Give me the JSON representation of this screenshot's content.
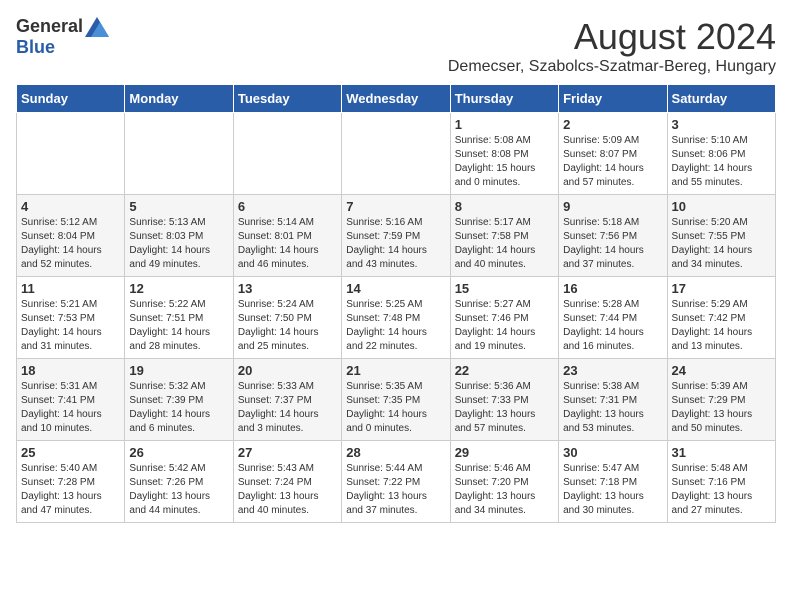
{
  "logo": {
    "general": "General",
    "blue": "Blue"
  },
  "title": {
    "month": "August 2024",
    "location": "Demecser, Szabolcs-Szatmar-Bereg, Hungary"
  },
  "header": {
    "days": [
      "Sunday",
      "Monday",
      "Tuesday",
      "Wednesday",
      "Thursday",
      "Friday",
      "Saturday"
    ]
  },
  "weeks": [
    {
      "days": [
        {
          "num": "",
          "info": ""
        },
        {
          "num": "",
          "info": ""
        },
        {
          "num": "",
          "info": ""
        },
        {
          "num": "",
          "info": ""
        },
        {
          "num": "1",
          "info": "Sunrise: 5:08 AM\nSunset: 8:08 PM\nDaylight: 15 hours\nand 0 minutes."
        },
        {
          "num": "2",
          "info": "Sunrise: 5:09 AM\nSunset: 8:07 PM\nDaylight: 14 hours\nand 57 minutes."
        },
        {
          "num": "3",
          "info": "Sunrise: 5:10 AM\nSunset: 8:06 PM\nDaylight: 14 hours\nand 55 minutes."
        }
      ]
    },
    {
      "days": [
        {
          "num": "4",
          "info": "Sunrise: 5:12 AM\nSunset: 8:04 PM\nDaylight: 14 hours\nand 52 minutes."
        },
        {
          "num": "5",
          "info": "Sunrise: 5:13 AM\nSunset: 8:03 PM\nDaylight: 14 hours\nand 49 minutes."
        },
        {
          "num": "6",
          "info": "Sunrise: 5:14 AM\nSunset: 8:01 PM\nDaylight: 14 hours\nand 46 minutes."
        },
        {
          "num": "7",
          "info": "Sunrise: 5:16 AM\nSunset: 7:59 PM\nDaylight: 14 hours\nand 43 minutes."
        },
        {
          "num": "8",
          "info": "Sunrise: 5:17 AM\nSunset: 7:58 PM\nDaylight: 14 hours\nand 40 minutes."
        },
        {
          "num": "9",
          "info": "Sunrise: 5:18 AM\nSunset: 7:56 PM\nDaylight: 14 hours\nand 37 minutes."
        },
        {
          "num": "10",
          "info": "Sunrise: 5:20 AM\nSunset: 7:55 PM\nDaylight: 14 hours\nand 34 minutes."
        }
      ]
    },
    {
      "days": [
        {
          "num": "11",
          "info": "Sunrise: 5:21 AM\nSunset: 7:53 PM\nDaylight: 14 hours\nand 31 minutes."
        },
        {
          "num": "12",
          "info": "Sunrise: 5:22 AM\nSunset: 7:51 PM\nDaylight: 14 hours\nand 28 minutes."
        },
        {
          "num": "13",
          "info": "Sunrise: 5:24 AM\nSunset: 7:50 PM\nDaylight: 14 hours\nand 25 minutes."
        },
        {
          "num": "14",
          "info": "Sunrise: 5:25 AM\nSunset: 7:48 PM\nDaylight: 14 hours\nand 22 minutes."
        },
        {
          "num": "15",
          "info": "Sunrise: 5:27 AM\nSunset: 7:46 PM\nDaylight: 14 hours\nand 19 minutes."
        },
        {
          "num": "16",
          "info": "Sunrise: 5:28 AM\nSunset: 7:44 PM\nDaylight: 14 hours\nand 16 minutes."
        },
        {
          "num": "17",
          "info": "Sunrise: 5:29 AM\nSunset: 7:42 PM\nDaylight: 14 hours\nand 13 minutes."
        }
      ]
    },
    {
      "days": [
        {
          "num": "18",
          "info": "Sunrise: 5:31 AM\nSunset: 7:41 PM\nDaylight: 14 hours\nand 10 minutes."
        },
        {
          "num": "19",
          "info": "Sunrise: 5:32 AM\nSunset: 7:39 PM\nDaylight: 14 hours\nand 6 minutes."
        },
        {
          "num": "20",
          "info": "Sunrise: 5:33 AM\nSunset: 7:37 PM\nDaylight: 14 hours\nand 3 minutes."
        },
        {
          "num": "21",
          "info": "Sunrise: 5:35 AM\nSunset: 7:35 PM\nDaylight: 14 hours\nand 0 minutes."
        },
        {
          "num": "22",
          "info": "Sunrise: 5:36 AM\nSunset: 7:33 PM\nDaylight: 13 hours\nand 57 minutes."
        },
        {
          "num": "23",
          "info": "Sunrise: 5:38 AM\nSunset: 7:31 PM\nDaylight: 13 hours\nand 53 minutes."
        },
        {
          "num": "24",
          "info": "Sunrise: 5:39 AM\nSunset: 7:29 PM\nDaylight: 13 hours\nand 50 minutes."
        }
      ]
    },
    {
      "days": [
        {
          "num": "25",
          "info": "Sunrise: 5:40 AM\nSunset: 7:28 PM\nDaylight: 13 hours\nand 47 minutes."
        },
        {
          "num": "26",
          "info": "Sunrise: 5:42 AM\nSunset: 7:26 PM\nDaylight: 13 hours\nand 44 minutes."
        },
        {
          "num": "27",
          "info": "Sunrise: 5:43 AM\nSunset: 7:24 PM\nDaylight: 13 hours\nand 40 minutes."
        },
        {
          "num": "28",
          "info": "Sunrise: 5:44 AM\nSunset: 7:22 PM\nDaylight: 13 hours\nand 37 minutes."
        },
        {
          "num": "29",
          "info": "Sunrise: 5:46 AM\nSunset: 7:20 PM\nDaylight: 13 hours\nand 34 minutes."
        },
        {
          "num": "30",
          "info": "Sunrise: 5:47 AM\nSunset: 7:18 PM\nDaylight: 13 hours\nand 30 minutes."
        },
        {
          "num": "31",
          "info": "Sunrise: 5:48 AM\nSunset: 7:16 PM\nDaylight: 13 hours\nand 27 minutes."
        }
      ]
    }
  ]
}
